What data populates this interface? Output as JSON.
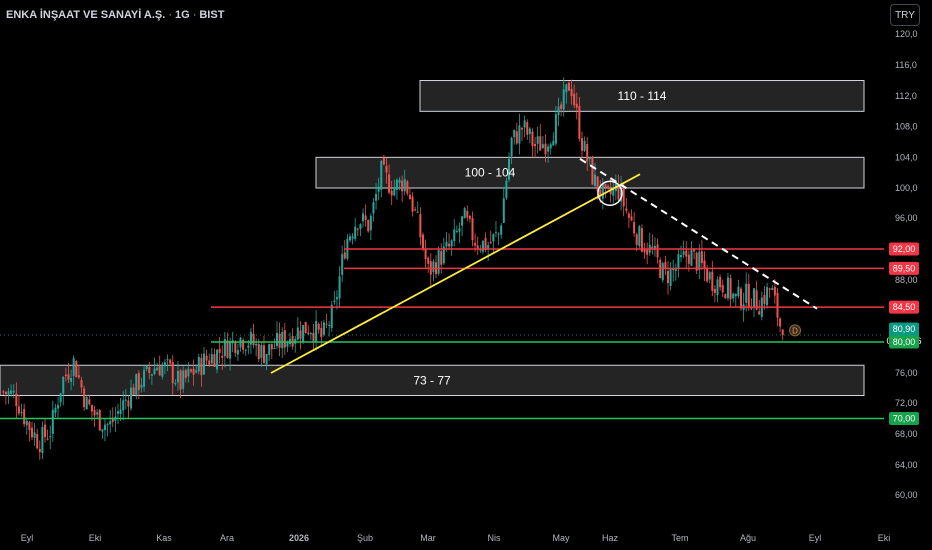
{
  "header": {
    "symbol": "ENKA İNŞAAT VE SANAYİ A.Ş.",
    "interval": "1G",
    "exchange": "BIST",
    "sep": "·",
    "currency": "TRY"
  },
  "colors": {
    "up": "#26a69a",
    "down": "#ef5350",
    "resistance": "#f23645",
    "support": "#22c55e",
    "trendline": "#ffeb3b",
    "zone_fill": "#2a2a2a",
    "zone_border": "#d1d4dc",
    "background": "#000000",
    "price_badge": "#089981"
  },
  "chart_data": {
    "type": "candlestick",
    "title": "ENKA İNŞAAT VE SANAYİ A.Ş. · 1G · BIST",
    "y_ticks": [
      120.0,
      116.0,
      112.0,
      108.0,
      104.0,
      100.0,
      96.0,
      88.0,
      76.0,
      72.0,
      68.0,
      64.0,
      60.0
    ],
    "y_tick_labels": [
      "120,0",
      "116,0",
      "112,0",
      "108,0",
      "104,0",
      "100,0",
      "96,00",
      "88,00",
      "76,00",
      "72,00",
      "68,00",
      "64,00",
      "60,00"
    ],
    "x_ticks": [
      "Eyl",
      "Eki",
      "Kas",
      "Ara",
      "2026",
      "Şub",
      "Mar",
      "Nis",
      "May",
      "Haz",
      "Tem",
      "Ağu",
      "Eyl",
      "Eki"
    ],
    "x_tick_bold": [
      false,
      false,
      false,
      false,
      true,
      false,
      false,
      false,
      false,
      false,
      false,
      false,
      false,
      false
    ],
    "price_path": [
      73.5,
      73.0,
      69.5,
      67.0,
      68.5,
      75.0,
      77.5,
      72.0,
      70.0,
      69.0,
      71.5,
      74.0,
      75.5,
      77.0,
      76.5,
      74.5,
      76.0,
      77.5,
      78.5,
      79.5,
      80.5,
      80.0,
      78.5,
      79.5,
      80.5,
      81.5,
      82.0,
      80.5,
      84.0,
      93.0,
      96.0,
      95.0,
      102.0,
      100.0,
      101.0,
      96.0,
      89.0,
      91.0,
      92.5,
      96.0,
      93.0,
      92.5,
      94.0,
      106.0,
      108.0,
      105.5,
      106.0,
      109.0,
      114.0,
      106.0,
      101.0,
      98.5,
      100.0,
      96.0,
      93.0,
      91.5,
      88.5,
      89.5,
      91.5,
      90.0,
      88.0,
      87.5,
      85.5,
      86.0,
      85.0,
      87.0,
      80.9
    ],
    "last_price": 80.9,
    "countdown": "01:58:46",
    "zones": [
      {
        "label": "110 - 114",
        "low": 110.0,
        "high": 114.0
      },
      {
        "label": "100 - 104",
        "low": 100.0,
        "high": 104.0
      },
      {
        "label": "73 - 77",
        "low": 73.0,
        "high": 77.0
      }
    ],
    "resistance_levels": [
      {
        "value": 92.0,
        "label": "92,00"
      },
      {
        "value": 89.5,
        "label": "89,50"
      },
      {
        "value": 84.5,
        "label": "84,50"
      }
    ],
    "support_levels": [
      {
        "value": 80.0,
        "label": "80,00"
      },
      {
        "value": 70.0,
        "label": "70,00"
      }
    ],
    "price_label": "80,90",
    "trendline": {
      "from": {
        "date": "Ara",
        "value": 76.0
      },
      "to": {
        "date": "Haz",
        "value": 101.5
      }
    },
    "downtrend": {
      "from": {
        "date": "May",
        "value": 103.5
      },
      "to": {
        "date": "Eyl",
        "value": 84.0
      }
    },
    "event_marker": "D"
  }
}
